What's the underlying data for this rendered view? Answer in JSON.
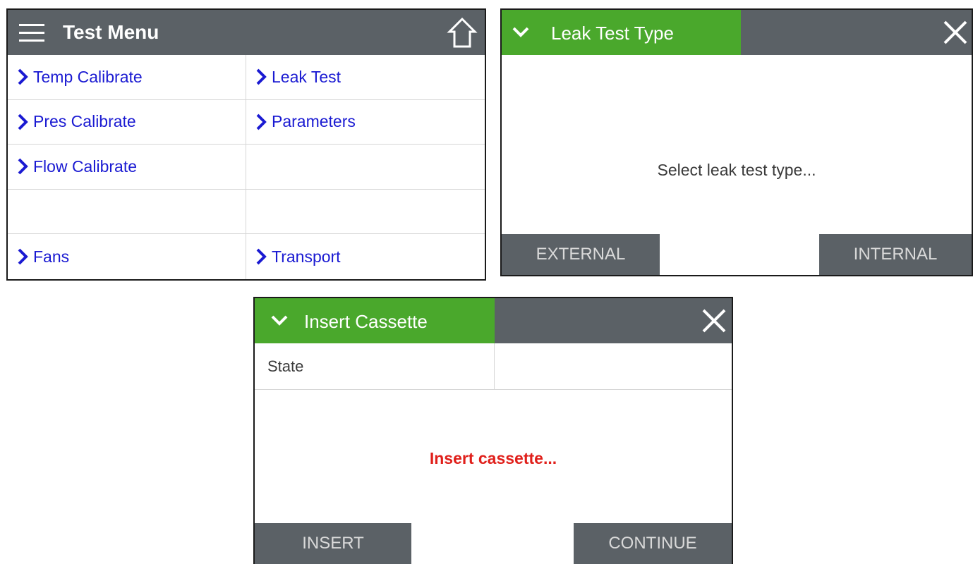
{
  "test_menu": {
    "title": "Test Menu",
    "menu_icon": "hamburger-icon",
    "home_icon": "home-icon",
    "items": [
      {
        "label": "Temp Calibrate"
      },
      {
        "label": "Leak Test"
      },
      {
        "label": "Pres Calibrate"
      },
      {
        "label": "Parameters"
      },
      {
        "label": "Flow Calibrate"
      },
      {
        "label": ""
      },
      {
        "label": ""
      },
      {
        "label": ""
      },
      {
        "label": "Fans"
      },
      {
        "label": "Transport"
      }
    ]
  },
  "leak_test": {
    "title": "Leak Test Type",
    "message": "Select leak test type...",
    "buttons": {
      "left": "EXTERNAL",
      "right": "INTERNAL"
    }
  },
  "insert_cassette": {
    "title": "Insert Cassette",
    "state_label": "State",
    "state_value": "",
    "message": "Insert cassette...",
    "buttons": {
      "left": "INSERT",
      "right": "CONTINUE"
    }
  },
  "colors": {
    "header_gray": "#5b6166",
    "header_green": "#4aa82c",
    "link_blue": "#1a1ad2",
    "alert_red": "#e0201b",
    "button_text": "#d9d9d9"
  }
}
